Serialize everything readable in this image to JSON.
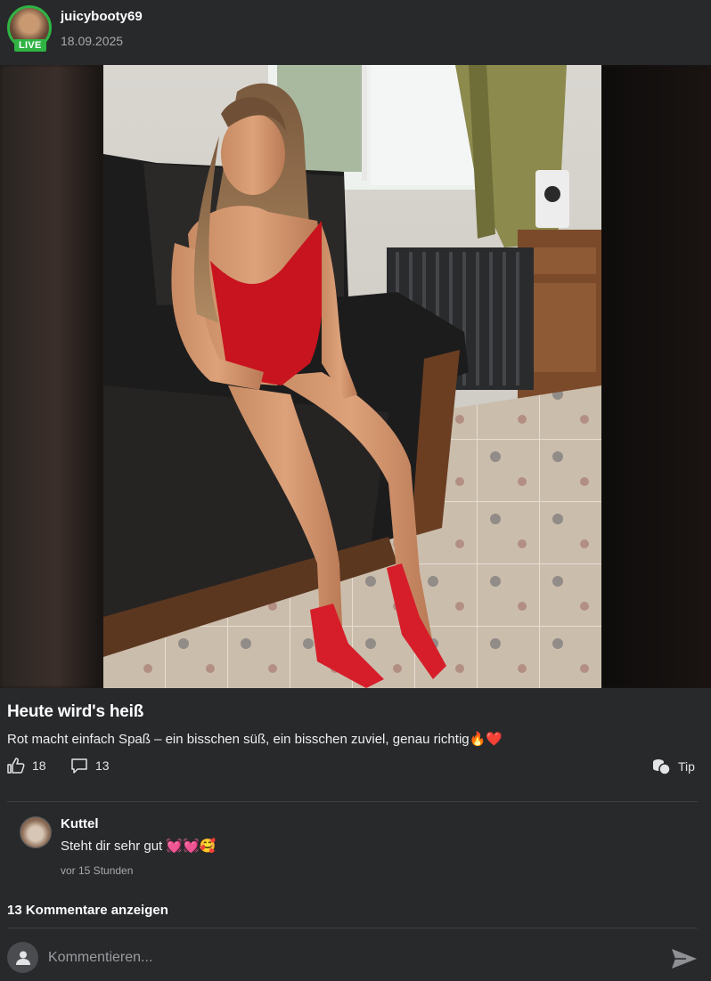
{
  "post": {
    "author": "juicybooty69",
    "live_badge": "LIVE",
    "date": "18.09.2025",
    "title": "Heute wird's heiß",
    "caption": "Rot macht einfach Spaß – ein bisschen süß, ein bisschen zuviel, genau richtig🔥❤️",
    "likes": "18",
    "comments_count": "13",
    "tip_label": "Tip"
  },
  "comment": {
    "author": "Kuttel",
    "text": "Steht dir sehr gut 💓💓🥰",
    "time": "vor 15 Stunden"
  },
  "show_comments_label": "13 Kommentare anzeigen",
  "input": {
    "placeholder": "Kommentieren..."
  },
  "colors": {
    "background": "#28292b",
    "live": "#2fb344",
    "muted": "#a7a9ad"
  }
}
